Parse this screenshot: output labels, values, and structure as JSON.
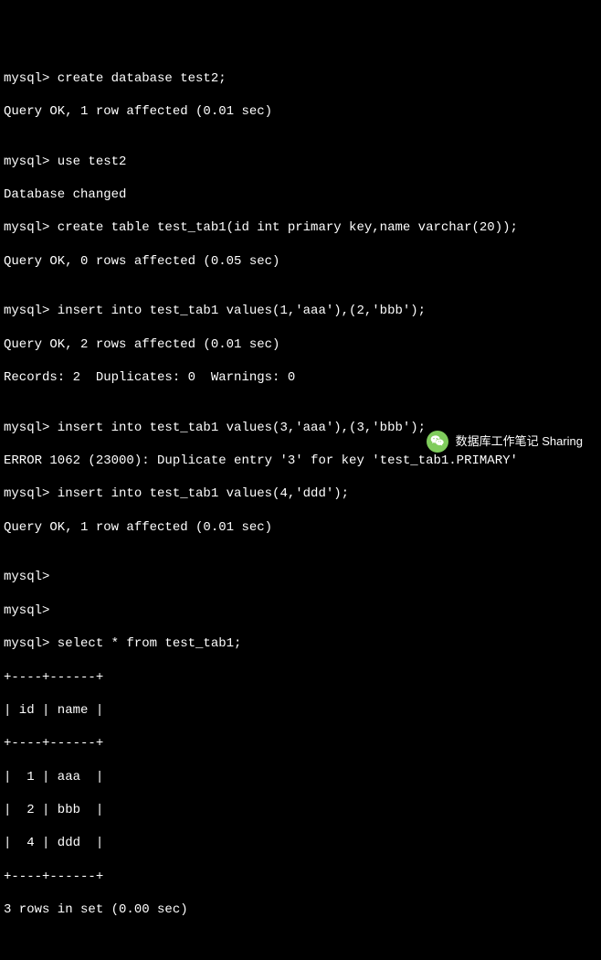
{
  "prompt": "mysql>",
  "lines": {
    "l1": "mysql> create database test2;",
    "l2": "Query OK, 1 row affected (0.01 sec)",
    "l3": "",
    "l4": "mysql> use test2",
    "l5": "Database changed",
    "l6": "mysql> create table test_tab1(id int primary key,name varchar(20));",
    "l7": "Query OK, 0 rows affected (0.05 sec)",
    "l8": "",
    "l9": "mysql> insert into test_tab1 values(1,'aaa'),(2,'bbb');",
    "l10": "Query OK, 2 rows affected (0.01 sec)",
    "l11": "Records: 2  Duplicates: 0  Warnings: 0",
    "l12": "",
    "l13": "mysql> insert into test_tab1 values(3,'aaa'),(3,'bbb');",
    "l14": "ERROR 1062 (23000): Duplicate entry '3' for key 'test_tab1.PRIMARY'",
    "l15": "mysql> insert into test_tab1 values(4,'ddd');",
    "l16": "Query OK, 1 row affected (0.01 sec)",
    "l17": "",
    "l18": "mysql>",
    "l19": "mysql>",
    "l20": "mysql> select * from test_tab1;",
    "l21": "+----+------+",
    "l22": "| id | name |",
    "l23": "+----+------+",
    "l24": "|  1 | aaa  |",
    "l25": "|  2 | bbb  |",
    "l26": "|  4 | ddd  |",
    "l27": "+----+------+",
    "l28": "3 rows in set (0.00 sec)"
  },
  "caption": "数据库工作笔记 Sharing",
  "chart_data": {
    "type": "table",
    "title": "test_tab1",
    "columns": [
      "id",
      "name"
    ],
    "rows": [
      {
        "id": 1,
        "name": "aaa"
      },
      {
        "id": 2,
        "name": "bbb"
      },
      {
        "id": 4,
        "name": "ddd"
      }
    ],
    "row_count": 3,
    "query_time_sec": 0.0
  }
}
